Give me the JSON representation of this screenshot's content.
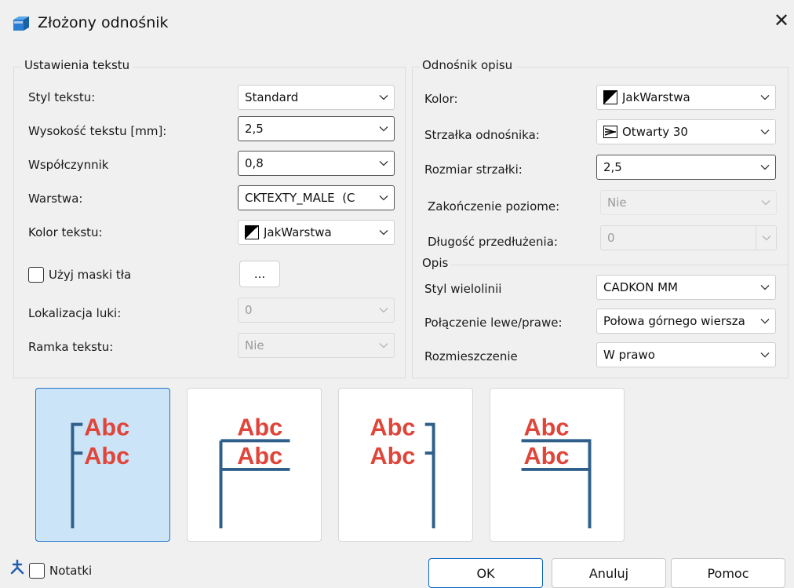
{
  "window": {
    "title": "Złożony odnośnik",
    "close_glyph": "✕"
  },
  "text_settings": {
    "group_title": "Ustawienia tekstu",
    "text_style_label": "Styl tekstu:",
    "text_style_value": "Standard",
    "text_height_label": "Wysokość tekstu [mm]:",
    "text_height_value": "2,5",
    "factor_label": "Współczynnik",
    "factor_value": "0,8",
    "layer_label": "Warstwa:",
    "layer_value": "CKTEXTY_MALE  (C",
    "text_color_label": "Kolor tekstu:",
    "text_color_value": "JakWarstwa",
    "bg_mask_label": "Użyj maski tła",
    "bg_mask_checked": false,
    "bg_mask_button": "...",
    "gap_location_label": "Lokalizacja luki:",
    "gap_location_value": "0",
    "text_frame_label": "Ramka tekstu:",
    "text_frame_value": "Nie"
  },
  "leader_settings": {
    "group_title": "Odnośnik opisu",
    "color_label": "Kolor:",
    "color_value": "JakWarstwa",
    "arrow_label": "Strzałka odnośnika:",
    "arrow_value": "Otwarty 30",
    "arrow_size_label": "Rozmiar strzałki:",
    "arrow_size_value": "2,5",
    "horizontal_end_label": "Zakończenie poziome:",
    "horizontal_end_value": "Nie",
    "extension_length_label": "Długość przedłużenia:",
    "extension_length_value": "0"
  },
  "description": {
    "group_title": "Opis",
    "mline_style_label": "Styl wielolinii",
    "mline_style_value": "CADKON MM",
    "connection_label": "Połączenie lewe/prawe:",
    "connection_value": "Połowa górnego wiersza",
    "placement_label": "Rozmieszczenie",
    "placement_value": "W prawo"
  },
  "tiles": {
    "sample_text": "Abc",
    "selected_index": 0,
    "colors": {
      "text": "#e0453a",
      "line": "#2f5f8a",
      "selected_bg": "#cce4f7",
      "selected_border": "#1f73c8"
    }
  },
  "footer": {
    "notes_label": "Notatki",
    "notes_checked": false,
    "ok_label": "OK",
    "cancel_label": "Anuluj",
    "help_label": "Pomoc"
  },
  "icons": [
    "app-icon",
    "close-icon",
    "chevron-down-icon",
    "color-swatch-icon",
    "arrow-style-icon",
    "cadkon-logo-icon"
  ]
}
